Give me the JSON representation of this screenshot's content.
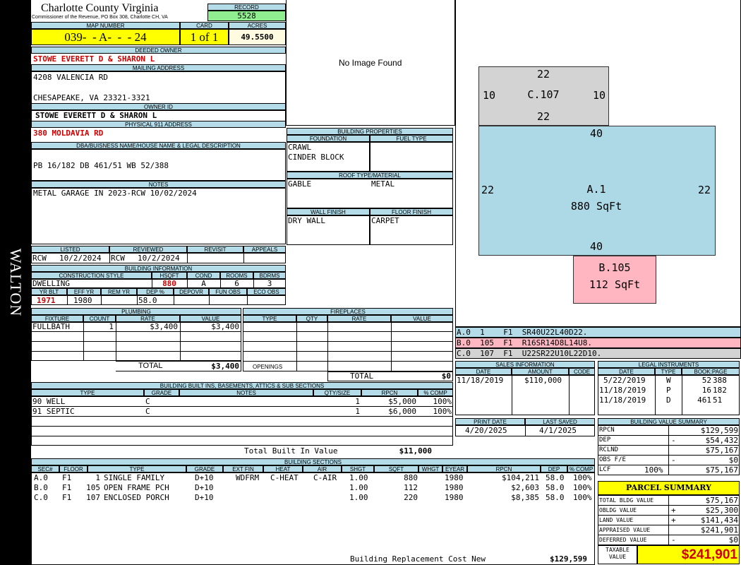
{
  "side_label": "WALTON",
  "header": {
    "county": "Charlotte County Virginia",
    "subtitle": "Commissioner of the Revenue, PO Box 308, Charlotte CH, VA",
    "record_label": "RECORD",
    "record": "5528",
    "map_label": "MAP NUMBER",
    "map": "039-  - A-  -  - 24",
    "card_label": "CARD",
    "card": "1 of 1",
    "acres_label": "ACRES",
    "acres": "49.5500"
  },
  "deeded_owner": {
    "label": "DEEDED OWNER",
    "value": "STOWE EVERETT D & SHARON L"
  },
  "mailing": {
    "label": "MAILING ADDRESS",
    "line1": "4208 VALENCIA RD",
    "line2": "CHESAPEAKE, VA 23321-3321"
  },
  "owner_id": {
    "label": "OWNER ID",
    "value": "STOWE EVERETT D & SHARON L"
  },
  "physical": {
    "label": "PHYSICAL 911 ADDRESS",
    "value": "380 MOLDAVIA RD"
  },
  "dba": {
    "label": "DBA/BUISNESS NAME/HOUSE NAME & LEGAL DESCRIPTION",
    "value": "PB 16/182 DB 461/51 WB 52/388"
  },
  "notes": {
    "label": "NOTES",
    "value": "METAL GARAGE IN 2023-RCW 10/02/2024"
  },
  "image": {
    "text": "No Image Found"
  },
  "building_props": {
    "label": "BUILDING PROPERTIES",
    "foundation_label": "FOUNDATION",
    "fuel_label": "FUEL TYPE",
    "foundation1": "CRAWL",
    "foundation2": "CINDER BLOCK",
    "roof_label": "ROOF TYPE/MATERIAL",
    "roof_type": "GABLE",
    "roof_mat": "METAL",
    "wall_label": "WALL FINISH",
    "floor_label": "FLOOR FINISH",
    "wall": "DRY WALL",
    "floor": "CARPET"
  },
  "listing": {
    "listed_label": "LISTED",
    "reviewed_label": "REVIEWED",
    "revisit_label": "REVISIT",
    "appeals_label": "APPEALS",
    "listed_by": "RCW",
    "listed_date": "10/2/2024",
    "reviewed_by": "RCW",
    "reviewed_date": "10/2/2024"
  },
  "building_info": {
    "label": "BUILDING INFORMATION",
    "style_label": "CONSTRUCTION STYLE",
    "hsqft_label": "HSQFT",
    "cond_label": "COND",
    "rooms_label": "ROOMS",
    "bdrms_label": "BDRMS",
    "style": "DWELLING",
    "hsqft": "880",
    "cond": "A",
    "rooms": "6",
    "bdrms": "3",
    "yrblt_label": "YR BLT",
    "effyr_label": "EFF YR",
    "remyr_label": "REM YR",
    "dep_label": "DEP %",
    "depovr_label": "DEPOVR",
    "funobs_label": "FUN OBS",
    "ecoobs_label": "ECO OBS",
    "yrblt": "1971",
    "effyr": "1980",
    "dep": "58.0"
  },
  "plumbing": {
    "label": "PLUMBING",
    "fixture_label": "FIXTURE",
    "count_label": "COUNT",
    "rate_label": "RATE",
    "value_label": "VALUE",
    "fixture": "FULLBATH",
    "count": "1",
    "rate": "$3,400",
    "value": "$3,400",
    "total_label": "TOTAL",
    "total": "$3,400"
  },
  "fireplaces": {
    "label": "FIREPLACES",
    "type_label": "TYPE",
    "qty_label": "QTY",
    "rate_label": "RATE",
    "value_label": "VALUE",
    "openings_label": "OPENINGS",
    "total_label": "TOTAL",
    "total": "$0"
  },
  "sketch": {
    "c_top": "22",
    "c_left": "10",
    "c_right": "10",
    "c_label": "C.107",
    "c_bottom": "22",
    "a_top": "40",
    "a_left": "22",
    "a_right": "22",
    "a_label": "A.1",
    "a_sqft": "880 SqFt",
    "a_bottom": "40",
    "b_label": "B.105",
    "b_sqft": "112 SqFt"
  },
  "sketch_codes": [
    {
      "text": "A.0  1    F1  SR40U22L40D22.",
      "color": "#b3dbe8"
    },
    {
      "text": "B.0  105  F1  R16SR14D8L14U8.",
      "color": "#ffb6c1"
    },
    {
      "text": "C.0  107  F1  U22SR22U10L22D10.",
      "color": "#d3d3d3"
    }
  ],
  "sales": {
    "label": "SALES INFORMATION",
    "date_label": "DATE",
    "amount_label": "AMOUNT",
    "code_label": "CODE",
    "date": "11/18/2019",
    "amount": "$110,000"
  },
  "legal": {
    "label": "LEGAL INSTRUMENTS",
    "date_label": "DATE",
    "type_label": "TYPE",
    "book_label": "BOOK:PAGE",
    "rows": [
      {
        "date": "5/22/2019",
        "type": "W",
        "book": "52",
        "page": "388"
      },
      {
        "date": "11/18/2019",
        "type": "P",
        "book": "16",
        "page": "182"
      },
      {
        "date": "11/18/2019",
        "type": "D",
        "book": "461",
        "page": "51"
      }
    ]
  },
  "print": {
    "print_label": "PRINT DATE",
    "saved_label": "LAST SAVED",
    "print_date": "4/20/2025",
    "saved_date": "4/1/2025"
  },
  "value_summary": {
    "label": "BUILDING VALUE SUMMARY",
    "rows": [
      {
        "k": "RPCN",
        "s": "",
        "v": "$129,599"
      },
      {
        "k": "DEP",
        "s": "-",
        "v": "$54,432"
      },
      {
        "k": "RCLND",
        "s": "",
        "v": "$75,167"
      },
      {
        "k": "OBS F/E",
        "s": "-",
        "v": "$0"
      },
      {
        "k": "LCF",
        "p": "100%",
        "s": "",
        "v": "$75,167"
      }
    ]
  },
  "parcel": {
    "label": "PARCEL SUMMARY",
    "rows": [
      {
        "k": "TOTAL BLDG VALUE",
        "s": "",
        "v": "$75,167"
      },
      {
        "k": "OBLDG VALUE",
        "s": "+",
        "v": "$25,300"
      },
      {
        "k": "LAND VALUE",
        "s": "+",
        "v": "$141,434"
      },
      {
        "k": "APPRAISED VALUE",
        "s": "",
        "v": "$241,901"
      },
      {
        "k": "DEFERRED VALUE",
        "s": "-",
        "v": "$0"
      }
    ],
    "taxable_label1": "TAXABLE",
    "taxable_label2": "VALUE",
    "taxable": "$241,901"
  },
  "builtins": {
    "label": "BUILDING BUILT INS, BASEMENTS, ATTICS & SUB SECTIONS",
    "cols": [
      "TYPE",
      "GRADE",
      "NOTES",
      "QTY/SIZE",
      "RPCN",
      "% COMP"
    ],
    "rows": [
      {
        "type": "90 WELL",
        "grade": "C",
        "qty": "1",
        "rpcn": "$5,000",
        "comp": "100%"
      },
      {
        "type": "91 SEPTIC",
        "grade": "C",
        "qty": "1",
        "rpcn": "$6,000",
        "comp": "100%"
      }
    ],
    "total_label": "Total Built In Value",
    "total": "$11,000"
  },
  "sections": {
    "label": "BUILDING SECTIONS",
    "cols": [
      "SEC#",
      "FLOOR",
      "TYPE",
      "GRADE",
      "EXT FIN",
      "HEAT",
      "AIR",
      "SHGT",
      "SQFT",
      "WHGT",
      "EYEAR",
      "RPCN",
      "DEP",
      "% COMP"
    ],
    "rows": [
      {
        "sec": "A.0",
        "floor": "F1",
        "code": "1",
        "type": "SINGLE FAMILY",
        "grade": "D+10",
        "ext": "WDFRM",
        "heat": "C-HEAT",
        "air": "C-AIR",
        "shgt": "1.00",
        "sqft": "880",
        "eyear": "1980",
        "rpcn": "$104,211",
        "dep": "58.0",
        "comp": "100%"
      },
      {
        "sec": "B.0",
        "floor": "F1",
        "code": "105",
        "type": "OPEN FRAME PCH",
        "grade": "D+10",
        "ext": "",
        "heat": "",
        "air": "",
        "shgt": "1.00",
        "sqft": "112",
        "eyear": "1980",
        "rpcn": "$2,603",
        "dep": "58.0",
        "comp": "100%"
      },
      {
        "sec": "C.0",
        "floor": "F1",
        "code": "107",
        "type": "ENCLOSED PORCH",
        "grade": "D+10",
        "ext": "",
        "heat": "",
        "air": "",
        "shgt": "1.00",
        "sqft": "220",
        "eyear": "1980",
        "rpcn": "$8,385",
        "dep": "58.0",
        "comp": "100%"
      }
    ],
    "rcn_label": "Building Replacement Cost New",
    "rcn": "$129,599"
  }
}
